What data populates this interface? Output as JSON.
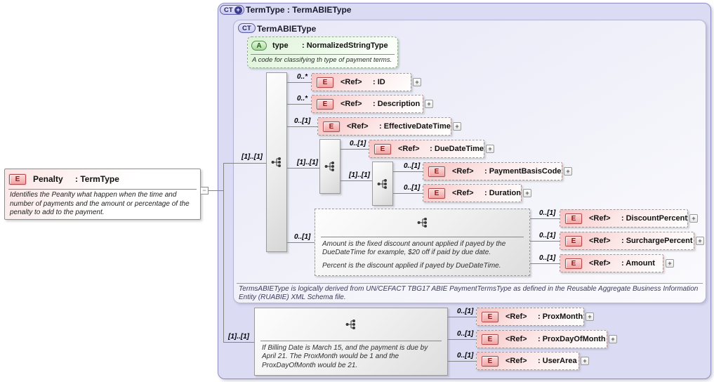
{
  "outer": {
    "badge": "CT",
    "badge_plus": "+",
    "title": "TermType : TermABIEType"
  },
  "inner": {
    "badge": "CT",
    "title": "TermABIEType",
    "footer": "TermsABIEType is logically derived from UN/CEFACT TBG17 ABIE PaymentTermsType as defined in the Reusable Aggregate Business Information Entity (RUABIE) XML Schema file."
  },
  "root": {
    "badge": "E",
    "name": "Penalty",
    "type": ": TermType",
    "doc": "Identifies the Peanlty what happen when the time and number of payments and the amount or percentage of the penalty to add to the payment.",
    "collapse_glyph": "−"
  },
  "attribute": {
    "badge": "A",
    "name": "type",
    "type": ": NormalizedStringType",
    "doc": "A code for classifying th type of payment terms."
  },
  "connectors": {
    "penalty_to_sequence": "[1]..[1]",
    "penalty_to_prox_group": "[1]..[1]",
    "sequence_to_due_group": "[1]..[1]",
    "due_group_to_basis_group": "[1]..[1]"
  },
  "glyphs": {
    "expand": "+"
  },
  "elements": [
    {
      "card": "0..*",
      "badge": "E",
      "label": "<Ref>",
      "type": ": ID"
    },
    {
      "card": "0..*",
      "badge": "E",
      "label": "<Ref>",
      "type": ": Description"
    },
    {
      "card": "0..[1]",
      "badge": "E",
      "label": "<Ref>",
      "type": ": EffectiveDateTime"
    },
    {
      "card": "0..[1]",
      "badge": "E",
      "label": "<Ref>",
      "type": ": DueDateTime"
    },
    {
      "card": "0..[1]",
      "badge": "E",
      "label": "<Ref>",
      "type": ": PaymentBasisCode"
    },
    {
      "card": "0..[1]",
      "badge": "E",
      "label": "<Ref>",
      "type": ": Duration"
    },
    {
      "card": "0..[1]",
      "badge": "E",
      "label": "<Ref>",
      "type": ": DiscountPercent"
    },
    {
      "card": "0..[1]",
      "badge": "E",
      "label": "<Ref>",
      "type": ": SurchargePercent"
    },
    {
      "card": "0..[1]",
      "badge": "E",
      "label": "<Ref>",
      "type": ": Amount"
    },
    {
      "card": "0..[1]",
      "badge": "E",
      "label": "<Ref>",
      "type": ": ProxMonth"
    },
    {
      "card": "0..[1]",
      "badge": "E",
      "label": "<Ref>",
      "type": ": ProxDayOfMonth"
    },
    {
      "card": "0..[1]",
      "badge": "E",
      "label": "<Ref>",
      "type": ": UserArea"
    }
  ],
  "doc_discount": {
    "line1": "Amount is the fixed discount anount applied if payed by the DueDateTime for example, $20 off if paid by due date.",
    "line2": "Percent is the discount applied if payed by DueDateTime."
  },
  "doc_prox": {
    "text": "If Billing Date is March 15, and the payment is due by April 21. The ProxMonth would be 1 and the ProxDayOfMonth would be 21."
  }
}
